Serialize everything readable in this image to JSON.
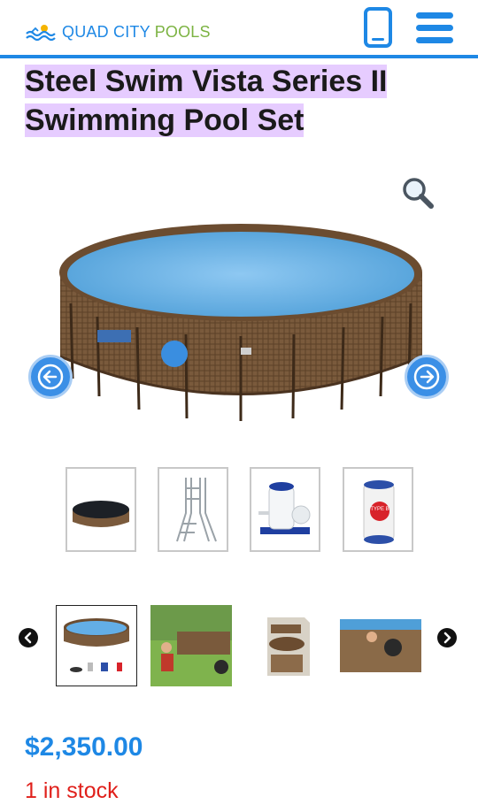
{
  "header": {
    "logo_quad": "QUAD CITY ",
    "logo_pools": "POOLS",
    "logo_icon": "pool-wave-logo",
    "phone_icon": "phone-icon",
    "menu_icon": "hamburger-menu-icon",
    "accent_color": "#1e88e5"
  },
  "product": {
    "title": "Steel Swim Vista Series II Swimming Pool Set",
    "price": "$2,350.00",
    "stock": "1 in stock",
    "price_color": "#1e88e5",
    "stock_color": "#e0201b"
  },
  "accessories": [
    {
      "name": "pool-cover"
    },
    {
      "name": "pool-ladder"
    },
    {
      "name": "filter-pump",
      "label": ""
    },
    {
      "name": "filter-cartridge",
      "label": "TYPE B"
    }
  ],
  "gallery": {
    "selected_index": 0,
    "items": [
      {
        "name": "pool-set-overview"
      },
      {
        "name": "backyard-family-scene"
      },
      {
        "name": "pool-box-package"
      },
      {
        "name": "pool-in-use-scene"
      }
    ]
  }
}
